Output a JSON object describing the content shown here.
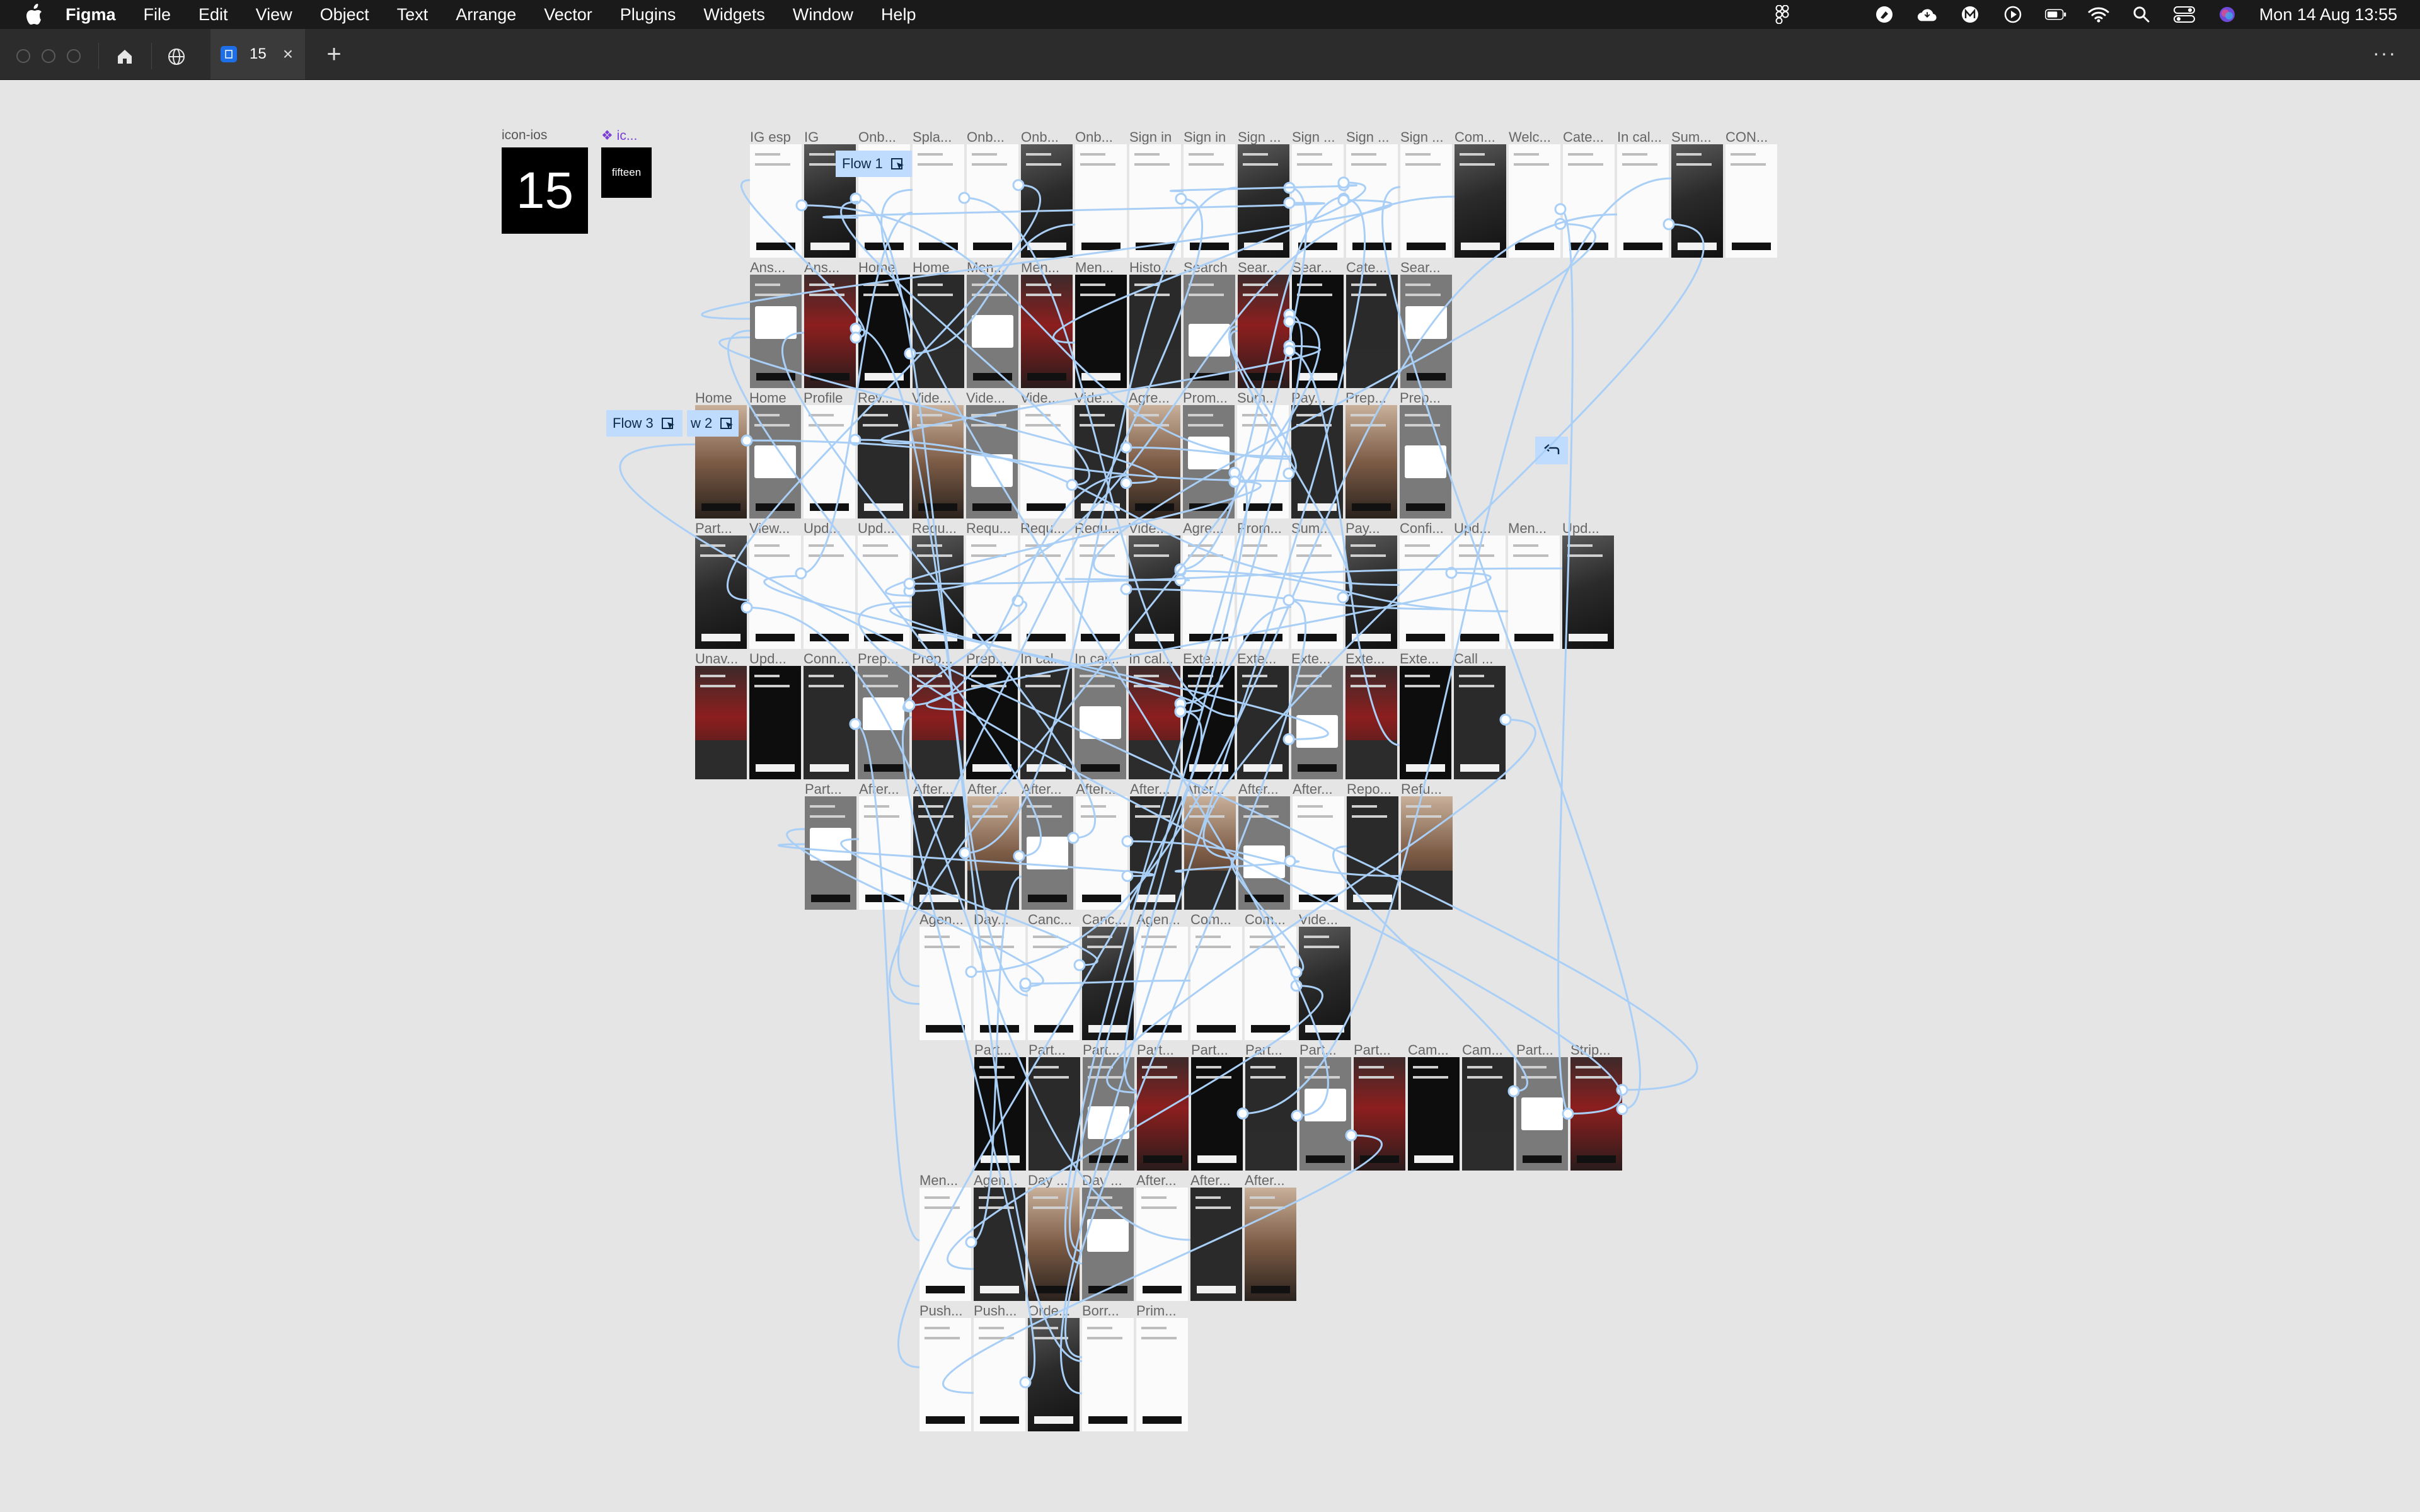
{
  "menubar": {
    "app_name": "Figma",
    "items": [
      "File",
      "Edit",
      "View",
      "Object",
      "Text",
      "Arrange",
      "Vector",
      "Plugins",
      "Widgets",
      "Window",
      "Help"
    ],
    "clock": "Mon 14 Aug  13:55",
    "status_icons": [
      "figma-icon",
      "app-icon",
      "cloud-icon",
      "app-icon",
      "play-icon",
      "battery-icon",
      "wifi-icon",
      "search-icon",
      "control-center-icon",
      "siri-icon"
    ]
  },
  "tabbar": {
    "active_tab": "15",
    "icons": [
      "home-icon",
      "globe-icon",
      "file-icon",
      "close-icon",
      "plus-icon",
      "more-icon"
    ]
  },
  "canvas": {
    "components": {
      "icon_ios_label": "icon-ios",
      "icon_ios_value": "15",
      "ic_label": "❖ ic...",
      "fifteen_value": "fifteen"
    },
    "flows": [
      "Flow 1",
      "Flow 3",
      "w 2"
    ],
    "connector_color": "#a9cff7",
    "rows": [
      [
        "IG esp",
        "IG",
        "Onb...",
        "Spla...",
        "Onb...",
        "Onb...",
        "Onb...",
        "Sign in",
        "Sign in",
        "Sign ...",
        "Sign ...",
        "Sign ...",
        "Sign ...",
        "Com...",
        "Welc...",
        "Cate...",
        "In cal...",
        "Sum...",
        "CON..."
      ],
      [
        "Ans...",
        "Ans...",
        "Home",
        "Home",
        "Men...",
        "Men...",
        "Men...",
        "Histo...",
        "Search",
        "Sear...",
        "Sear...",
        "Cate...",
        "Sear..."
      ],
      [
        "Home",
        "Home",
        "Profile",
        "Rev...",
        "Vide...",
        "Vide...",
        "Vide...",
        "Vide...",
        "Agre...",
        "Prom...",
        "Sum...",
        "Pay...",
        "Prep...",
        "Prep..."
      ],
      [
        "Part...",
        "View...",
        "Upd...",
        "Upd...",
        "Requ...",
        "Requ...",
        "Requ...",
        "Requ...",
        "Vide...",
        "Agre...",
        "Prom...",
        "Sum...",
        "Pay...",
        "Confi...",
        "Upd...",
        "Men...",
        "Upd..."
      ],
      [
        "Unav...",
        "Upd...",
        "Conn...",
        "Prep...",
        "Prep...",
        "Prep...",
        "In cal...",
        "In cal...",
        "In cal...",
        "Exte...",
        "Exte...",
        "Exte...",
        "Exte...",
        "Exte...",
        "Call ..."
      ],
      [
        "Part...",
        "After...",
        "After...",
        "After...",
        "After...",
        "After...",
        "After...",
        "After...",
        "After...",
        "After...",
        "Repo...",
        "Refu..."
      ],
      [
        "Agen...",
        "Day...",
        "Canc...",
        "Canc...",
        "Agen...",
        "Com...",
        "Com...",
        "Vide..."
      ],
      [
        "Part...",
        "Part...",
        "Part...",
        "Part...",
        "Part...",
        "Part...",
        "Part...",
        "Part...",
        "Cam...",
        "Cam...",
        "Part...",
        "Strip..."
      ],
      [
        "Men...",
        "Agen...",
        "Day ...",
        "Day ...",
        "After...",
        "After...",
        "After..."
      ],
      [
        "Push...",
        "Push...",
        "Orde...",
        "Borr...",
        "Prim..."
      ]
    ]
  }
}
